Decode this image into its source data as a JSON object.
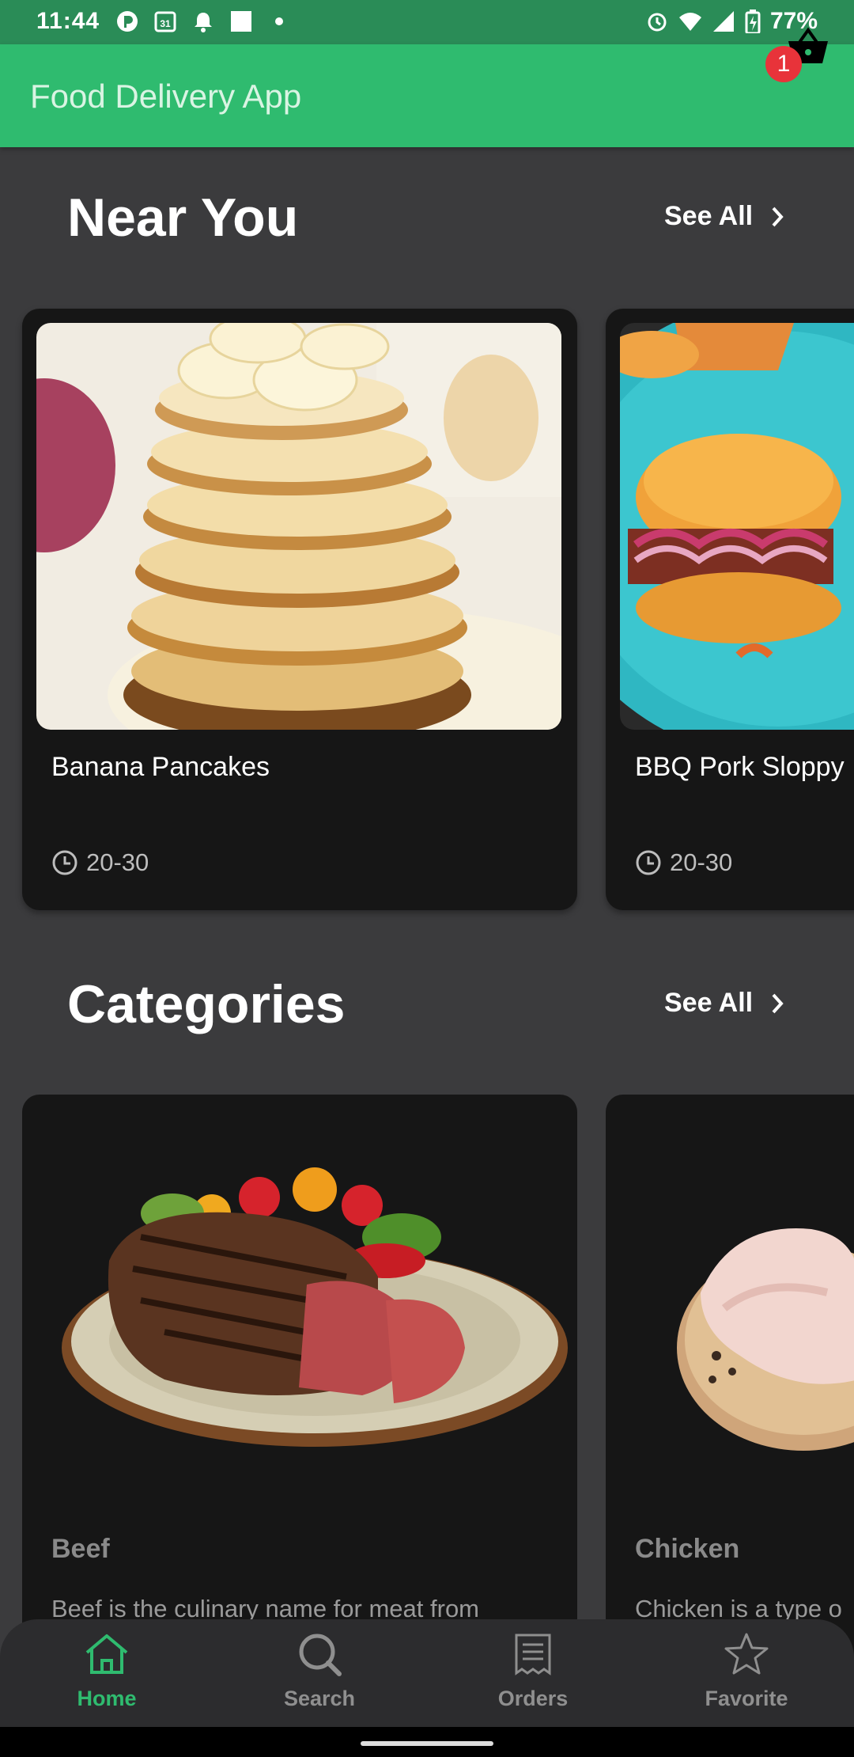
{
  "status_bar": {
    "time": "11:44",
    "calendar_day": "31",
    "battery": "77%"
  },
  "app_bar": {
    "title": "Food Delivery App",
    "cart_badge": "1"
  },
  "near_you": {
    "title": "Near You",
    "see_all": "See All",
    "items": [
      {
        "name": "Banana Pancakes",
        "time": "20-30"
      },
      {
        "name": "BBQ Pork Sloppy",
        "time": "20-30"
      }
    ]
  },
  "categories": {
    "title": "Categories",
    "see_all": "See All",
    "items": [
      {
        "name": "Beef",
        "description": "Beef is the culinary name for meat from"
      },
      {
        "name": "Chicken",
        "description": "Chicken is a type o"
      }
    ]
  },
  "bottom_nav": {
    "items": [
      {
        "label": "Home",
        "icon": "home-icon",
        "active": true
      },
      {
        "label": "Search",
        "icon": "search-icon",
        "active": false
      },
      {
        "label": "Orders",
        "icon": "receipt-icon",
        "active": false
      },
      {
        "label": "Favorite",
        "icon": "star-icon",
        "active": false
      }
    ]
  },
  "colors": {
    "status_bar": "#2a8c57",
    "app_bar": "#2fbb6f",
    "background": "#3b3b3d",
    "card": "#161616",
    "active_nav": "#2fbb6f",
    "badge": "#e8333a"
  }
}
